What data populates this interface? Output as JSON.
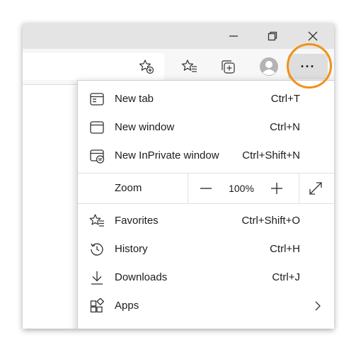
{
  "menu": {
    "new_tab": {
      "label": "New tab",
      "shortcut": "Ctrl+T"
    },
    "new_window": {
      "label": "New window",
      "shortcut": "Ctrl+N"
    },
    "new_inprivate": {
      "label": "New InPrivate window",
      "shortcut": "Ctrl+Shift+N"
    },
    "zoom": {
      "label": "Zoom",
      "minus": "—",
      "value": "100%",
      "plus": "+"
    },
    "favorites": {
      "label": "Favorites",
      "shortcut": "Ctrl+Shift+O"
    },
    "history": {
      "label": "History",
      "shortcut": "Ctrl+H"
    },
    "downloads": {
      "label": "Downloads",
      "shortcut": "Ctrl+J"
    },
    "apps": {
      "label": "Apps"
    }
  },
  "toolbar": {
    "more_button": "···"
  },
  "colors": {
    "highlight_circle": "#f39019",
    "titlebar": "#e4e4e4",
    "menu_background": "#ffffff",
    "more_button_active": "#dedede"
  },
  "icons": [
    "minimize-icon",
    "maximize-icon",
    "close-icon",
    "favorite-add-icon",
    "favorites-icon",
    "collections-icon",
    "profile-icon",
    "more-icon",
    "new-tab-icon",
    "new-window-icon",
    "inprivate-icon",
    "zoom-out-icon",
    "zoom-in-icon",
    "fullscreen-icon",
    "history-icon",
    "download-icon",
    "apps-icon",
    "chevron-right-icon",
    "settings-icon"
  ]
}
